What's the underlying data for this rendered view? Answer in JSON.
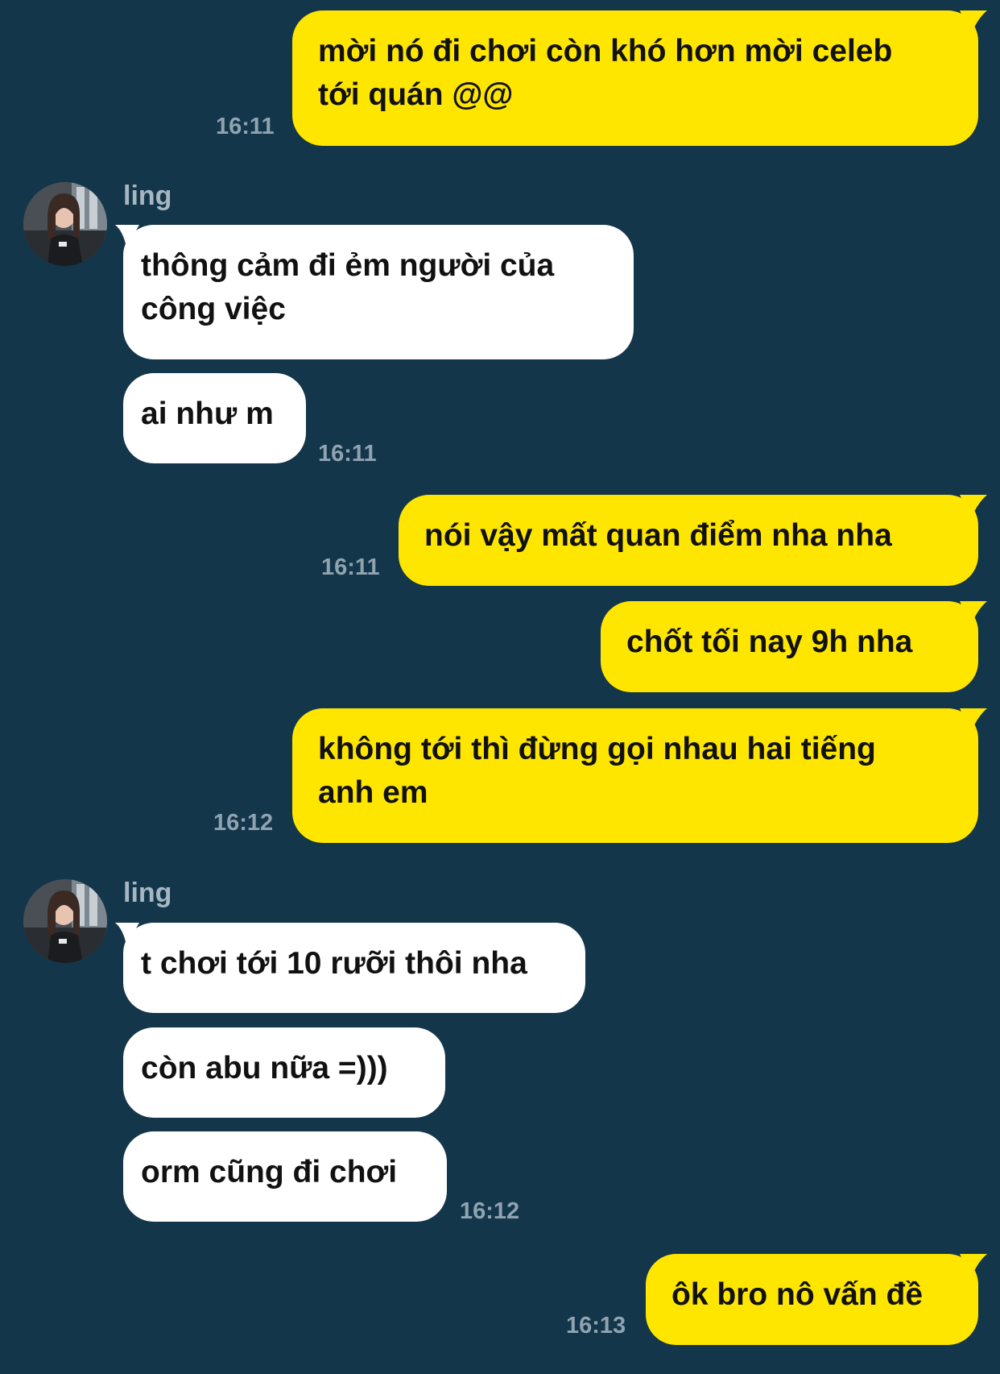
{
  "contact": {
    "name": "ling"
  },
  "messages": [
    {
      "side": "out",
      "text": "mời nó đi chơi còn khó hơn mời celeb\ntới quán @@",
      "time": "16:11"
    },
    {
      "side": "in",
      "text": "thông cảm đi ẻm người của\ncông việc"
    },
    {
      "side": "in",
      "text": "ai như m",
      "time": "16:11"
    },
    {
      "side": "out",
      "text": "nói vậy mất quan điểm nha nha",
      "time": "16:11"
    },
    {
      "side": "out",
      "text": "chốt tối nay 9h nha"
    },
    {
      "side": "out",
      "text": "không tới thì đừng gọi nhau hai tiếng\nanh em",
      "time": "16:12"
    },
    {
      "side": "in",
      "text": "t chơi tới 10 rưỡi thôi nha"
    },
    {
      "side": "in",
      "text": "còn abu nữa =)))"
    },
    {
      "side": "in",
      "text": "orm cũng đi chơi",
      "time": "16:12"
    },
    {
      "side": "out",
      "text": "ôk bro nô vấn đề",
      "time": "16:13"
    }
  ],
  "colors": {
    "background": "#14364a",
    "outgoing_bubble": "#ffe600",
    "incoming_bubble": "#ffffff",
    "timestamp": "#8fa3b1"
  }
}
